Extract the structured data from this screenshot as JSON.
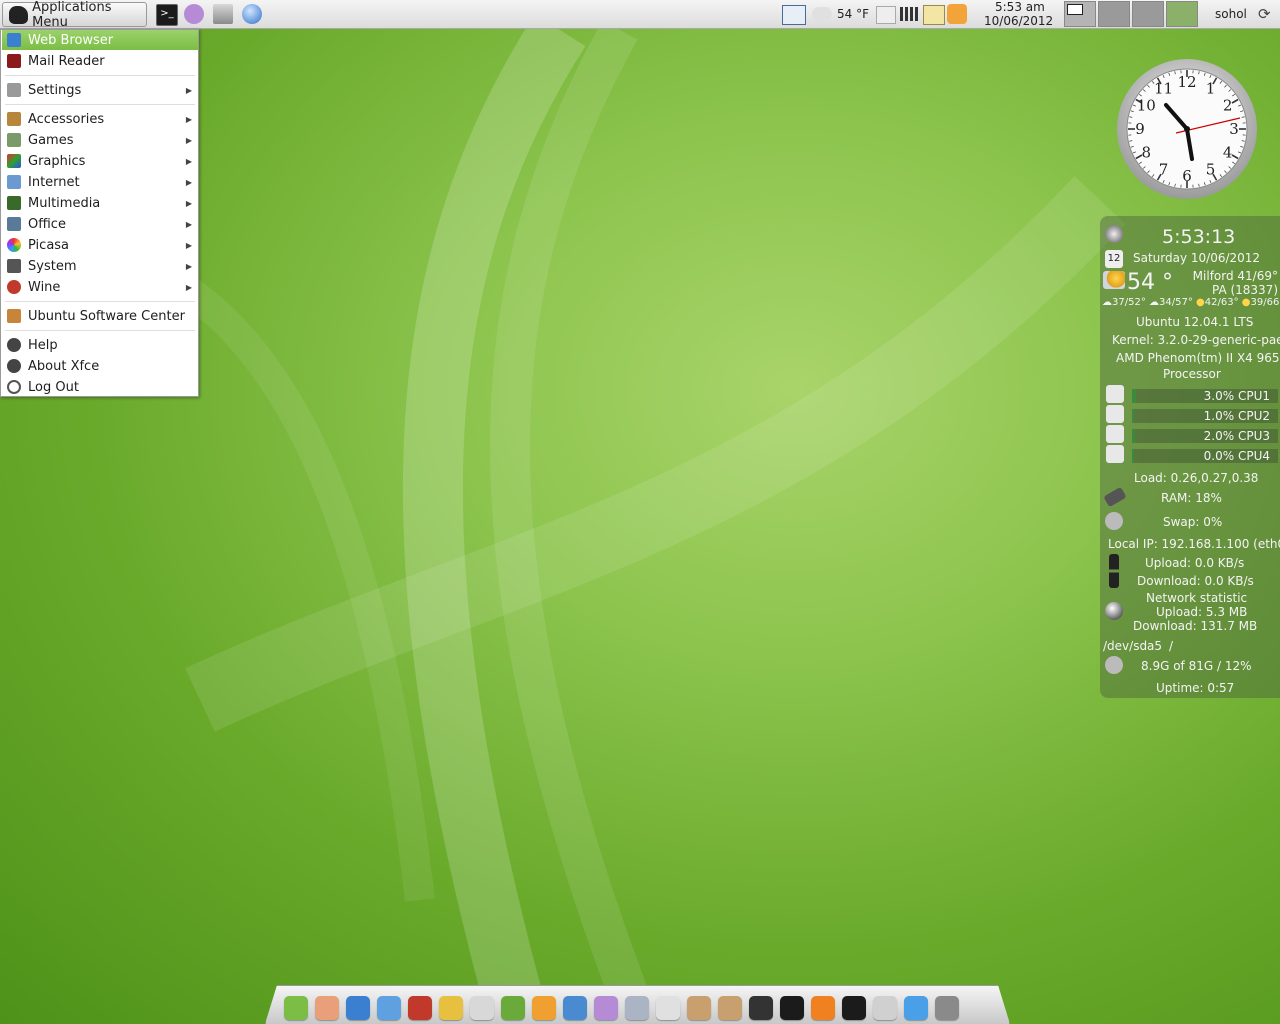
{
  "top_panel": {
    "apps_menu_label": "Applications Menu",
    "launchers": [
      "terminal-icon",
      "pidgin-icon",
      "files-icon",
      "web-browser-icon"
    ],
    "weather": "54 °F",
    "time": "5:53 am",
    "date": "10/06/2012",
    "user": "sohol"
  },
  "app_menu": {
    "items": [
      {
        "label": "Web Browser",
        "icon": "web-browser-icon",
        "highlighted": true
      },
      {
        "label": "Mail Reader",
        "icon": "mail-icon"
      },
      {
        "label": "Settings",
        "icon": "settings-icon",
        "submenu": true
      },
      {
        "label": "Accessories",
        "icon": "accessories-icon",
        "submenu": true
      },
      {
        "label": "Games",
        "icon": "games-icon",
        "submenu": true
      },
      {
        "label": "Graphics",
        "icon": "graphics-icon",
        "submenu": true
      },
      {
        "label": "Internet",
        "icon": "internet-icon",
        "submenu": true
      },
      {
        "label": "Multimedia",
        "icon": "multimedia-icon",
        "submenu": true
      },
      {
        "label": "Office",
        "icon": "office-icon",
        "submenu": true
      },
      {
        "label": "Picasa",
        "icon": "picasa-icon",
        "submenu": true
      },
      {
        "label": "System",
        "icon": "system-icon",
        "submenu": true
      },
      {
        "label": "Wine",
        "icon": "wine-icon",
        "submenu": true
      },
      {
        "label": "Ubuntu Software Center",
        "icon": "software-center-icon"
      },
      {
        "label": "Help",
        "icon": "help-icon"
      },
      {
        "label": "About Xfce",
        "icon": "info-icon"
      },
      {
        "label": "Log Out",
        "icon": "logout-icon"
      }
    ]
  },
  "clock": {
    "numerals": [
      "12",
      "1",
      "2",
      "3",
      "4",
      "5",
      "6",
      "7",
      "8",
      "9",
      "10",
      "11"
    ]
  },
  "conky": {
    "time": "5:53:13",
    "calendar_day": "12",
    "date": "Saturday 10/06/2012",
    "temp": "54 °",
    "location_line1": "Milford 41/69°",
    "location_line2": "PA (18337)",
    "forecast": [
      "37/52°",
      "34/57°",
      "42/63°",
      "39/66°"
    ],
    "os": "Ubuntu 12.04.1 LTS",
    "kernel": "Kernel: 3.2.0-29-generic-pae",
    "cpu_name_line1": "AMD Phenom(tm) II X4 965",
    "cpu_name_line2": "Processor",
    "cpus": [
      {
        "label": "3.0% CPU1",
        "percent": 3.0
      },
      {
        "label": "1.0% CPU2",
        "percent": 1.0
      },
      {
        "label": "2.0% CPU3",
        "percent": 2.0
      },
      {
        "label": "0.0% CPU4",
        "percent": 0.0
      }
    ],
    "load": "Load: 0.26,0.27,0.38",
    "ram": "RAM: 18%",
    "swap": "Swap: 0%",
    "local_ip": "Local IP: 192.168.1.100 (eth0)",
    "upload_rate": "Upload: 0.0 KB/s",
    "download_rate": "Download: 0.0 KB/s",
    "net_title": "Network statistic",
    "net_upload": "Upload: 5.3 MB",
    "net_download": "Download: 131.7 MB",
    "disk_dev": "/dev/sda5",
    "disk_mount": "/",
    "disk_usage": "8.9G of 81G / 12%",
    "uptime": "Uptime: 0:57"
  },
  "dock": {
    "icons": [
      "anchor-icon",
      "notes-icon",
      "globe-icon",
      "chromium-icon",
      "firewall-icon",
      "picasa-icon",
      "dvd-icon",
      "audio-icon",
      "bookmark-icon",
      "qbittorrent-icon",
      "pidgin-icon",
      "droplet-icon",
      "text-editor-icon",
      "archive-icon",
      "package-install-icon",
      "camera-icon",
      "terminal-icon",
      "eye-icon",
      "terminal-icon",
      "trash-icon",
      "desktop-icon",
      "workspaces-icon"
    ]
  }
}
